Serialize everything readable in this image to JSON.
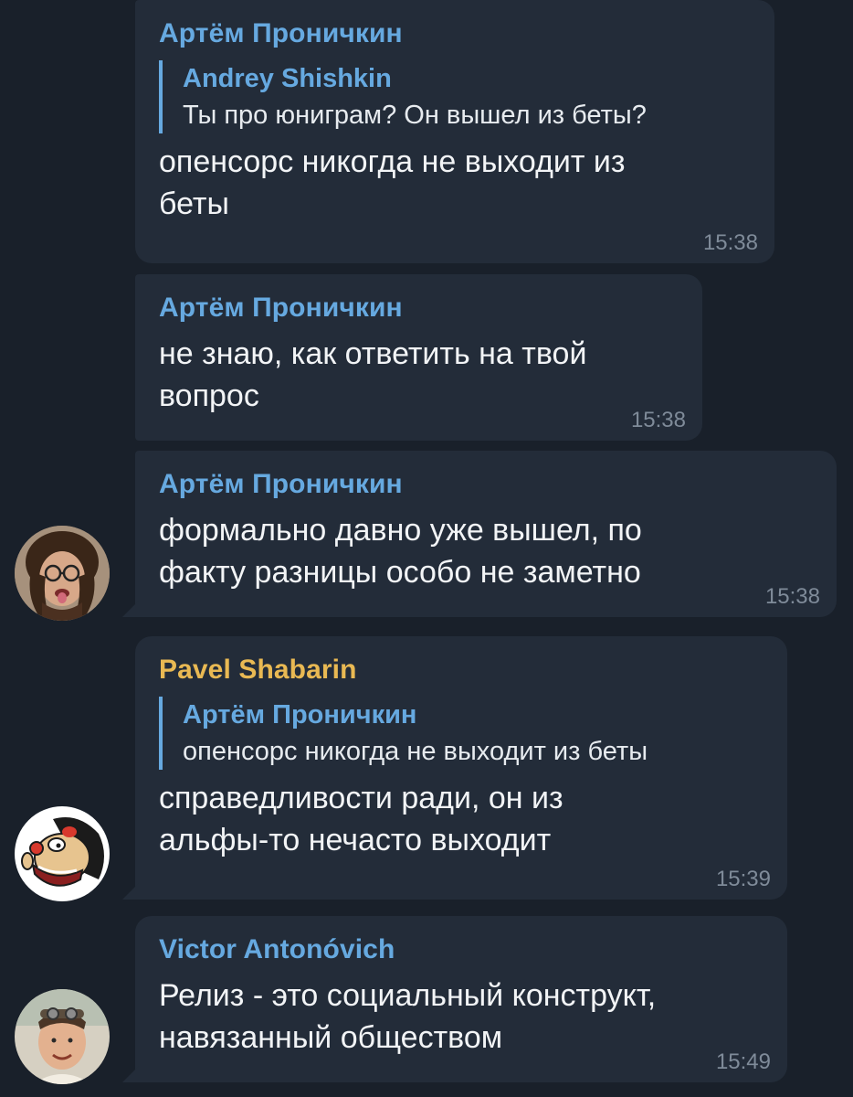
{
  "messages": [
    {
      "sender": "Артём Проничкин",
      "reply": {
        "name": "Andrey Shishkin",
        "text": "Ты про юниграм? Он вышел из беты?"
      },
      "lines": [
        "опенсорс никогда не выходит из",
        "беты"
      ],
      "time": "15:38"
    },
    {
      "sender": "Артём Проничкин",
      "lines": [
        "не знаю, как ответить на твой",
        "вопрос"
      ],
      "time": "15:38"
    },
    {
      "sender": "Артём Проничкин",
      "lines": [
        "формально давно уже вышел, по",
        "факту разницы особо не заметно"
      ],
      "time": "15:38"
    },
    {
      "sender": "Pavel Shabarin",
      "reply": {
        "name": "Артём Проничкин",
        "text": "опенсорс никогда не выходит из беты"
      },
      "lines": [
        "справедливости ради, он из",
        "альфы-то нечасто выходит"
      ],
      "time": "15:39"
    },
    {
      "sender": "Victor Antonóvich",
      "lines": [
        "Релиз - это социальный конструкт,",
        "навязанный обществом"
      ],
      "time": "15:49"
    }
  ],
  "colors": {
    "background": "#19202a",
    "bubble": "#232c39",
    "name_blue": "#66a9e0",
    "name_yellow": "#e9b953",
    "text": "#f2f4f6",
    "time": "#7f8b99"
  }
}
